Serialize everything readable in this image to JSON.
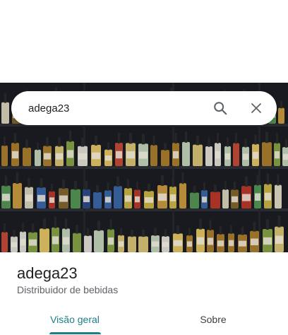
{
  "search": {
    "query": "adega23",
    "search_icon": "search-icon",
    "close_icon": "close-icon"
  },
  "place": {
    "photo_description_icon": "store-photo",
    "name": "adega23",
    "category": "Distribuidor de bebidas"
  },
  "tabs": [
    {
      "label": "Visão geral",
      "active": true
    },
    {
      "label": "Sobre",
      "active": false
    }
  ],
  "colors": {
    "accent": "#1a7f8a",
    "text_primary": "#202124",
    "text_secondary": "#5f6368"
  }
}
